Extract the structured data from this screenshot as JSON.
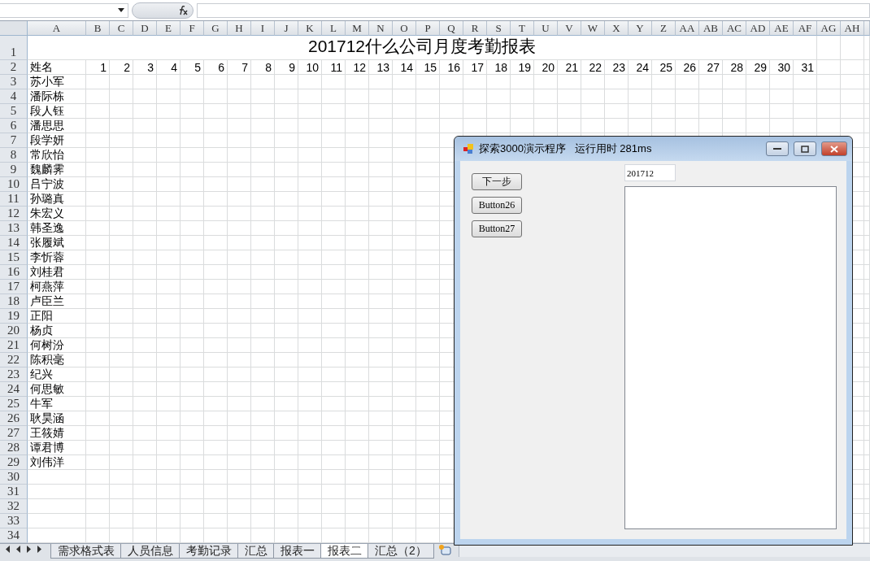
{
  "sheet": {
    "columns": [
      "A",
      "B",
      "C",
      "D",
      "E",
      "F",
      "G",
      "H",
      "I",
      "J",
      "K",
      "L",
      "M",
      "N",
      "O",
      "P",
      "Q",
      "R",
      "S",
      "T",
      "U",
      "V",
      "W",
      "X",
      "Y",
      "Z",
      "AA",
      "AB",
      "AC",
      "AD",
      "AE",
      "AF",
      "AG",
      "AH"
    ],
    "row_numbers": [
      "1",
      "2",
      "3",
      "4",
      "5",
      "6",
      "7",
      "8",
      "9",
      "10",
      "11",
      "12",
      "13",
      "14",
      "15",
      "16",
      "17",
      "18",
      "19",
      "20",
      "21",
      "22",
      "23",
      "24",
      "25",
      "26",
      "27",
      "28",
      "29",
      "30",
      "31",
      "32",
      "33",
      "34"
    ],
    "title": "201712什么公司月度考勤报表",
    "name_header": "姓名",
    "days": [
      "1",
      "2",
      "3",
      "4",
      "5",
      "6",
      "7",
      "8",
      "9",
      "10",
      "11",
      "12",
      "13",
      "14",
      "15",
      "16",
      "17",
      "18",
      "19",
      "20",
      "21",
      "22",
      "23",
      "24",
      "25",
      "26",
      "27",
      "28",
      "29",
      "30",
      "31"
    ],
    "names": [
      "苏小军",
      "潘际栋",
      "段人钰",
      "潘思思",
      "段学妍",
      "常欣怡",
      "魏麟霁",
      "吕宁波",
      "孙璐真",
      "朱宏义",
      "韩圣逸",
      "张履斌",
      "李忻蓉",
      "刘桂君",
      "柯燕萍",
      "卢臣兰",
      "正阳",
      "杨贞",
      "何树汾",
      "陈积毫",
      "纪兴",
      "何思敏",
      "牛军",
      "耿昊涵",
      "王筱婧",
      "谭君博",
      "刘伟洋"
    ]
  },
  "sheet_tabs": [
    {
      "label": "需求格式表",
      "selected": false
    },
    {
      "label": "人员信息",
      "selected": false
    },
    {
      "label": "考勤记录",
      "selected": false
    },
    {
      "label": "汇总",
      "selected": false
    },
    {
      "label": "报表一",
      "selected": false
    },
    {
      "label": "报表二",
      "selected": true
    },
    {
      "label": "汇总（2）",
      "selected": false
    }
  ],
  "dialog": {
    "title": "探索3000演示程序   运行用时 281ms",
    "buttons": [
      "下一步",
      "Button26",
      "Button27"
    ],
    "input": {
      "value": "201712"
    }
  }
}
